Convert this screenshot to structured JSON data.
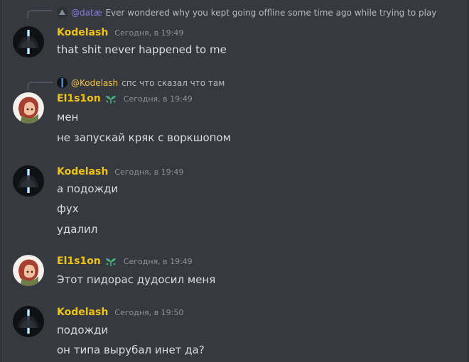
{
  "messages": [
    {
      "reply": {
        "name": "@datæ",
        "text": "Ever wondered why you kept going offline some time ago while trying to play"
      },
      "author": "Kodelash",
      "time": "Сегодня, в 19:49",
      "lines": [
        "that shit never happened to me"
      ]
    },
    {
      "reply": {
        "name": "@Kodelash",
        "text": "спс что сказал что там"
      },
      "author": "El1s1on",
      "time": "Сегодня, в 19:49",
      "lines": [
        "мен",
        "не запускай кряк с воркшопом"
      ]
    },
    {
      "author": "Kodelash",
      "time": "Сегодня, в 19:49",
      "lines": [
        "а подожди",
        "фух",
        "удалил"
      ]
    },
    {
      "author": "El1s1on",
      "time": "Сегодня, в 19:49",
      "lines": [
        "Этот пидорас дудосил меня"
      ]
    },
    {
      "author": "Kodelash",
      "time": "Сегодня, в 19:50",
      "lines": [
        "подожди",
        "он типа вырубал инет да?"
      ]
    }
  ],
  "colors": {
    "background": "#36393f",
    "username": "#f1c40f",
    "reply_mention_purple": "#8c7ae6",
    "reply_mention_gold": "#f5c542",
    "text": "#dcddde",
    "timestamp": "#8e9297"
  },
  "icons": {
    "kodelash_avatar": "lightsaber-avatar-icon",
    "elision_avatar": "anime-girl-avatar-icon",
    "elision_badge": "leaf-badge-icon"
  }
}
